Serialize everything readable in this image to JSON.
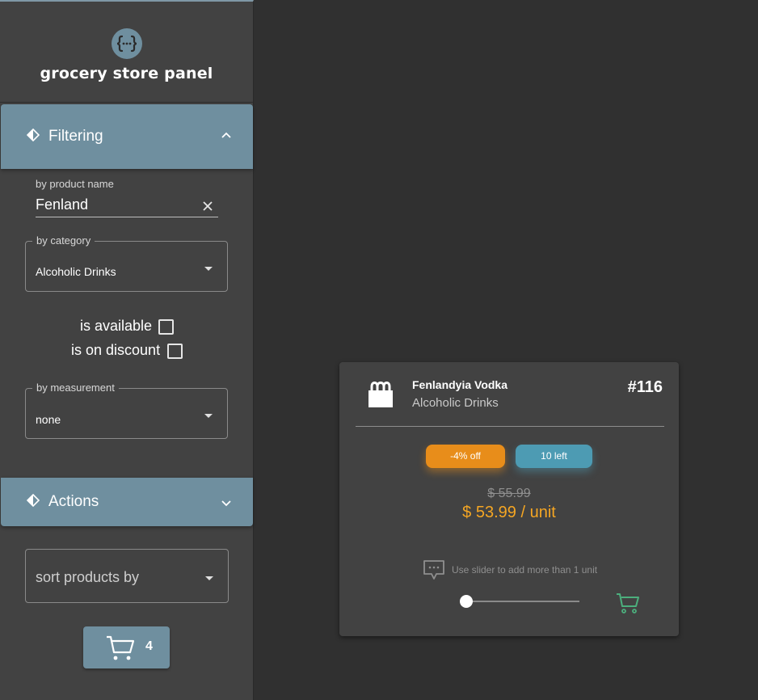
{
  "sidebar": {
    "title": "grocery store panel",
    "filtering": {
      "header_label": "Filtering",
      "name_filter": {
        "label": "by product name",
        "value": "Fenland"
      },
      "category_filter": {
        "label": "by category",
        "value": "Alcoholic Drinks"
      },
      "available_label": "is available",
      "available_checked": false,
      "discount_label": "is on discount",
      "discount_checked": false,
      "measurement_filter": {
        "label": "by measurement",
        "value": "none"
      }
    },
    "actions": {
      "header_label": "Actions"
    },
    "sort_select": {
      "placeholder": "sort products by"
    },
    "cart": {
      "count": "4"
    }
  },
  "product": {
    "name": "Fenlandyia Vodka",
    "category": "Alcoholic Drinks",
    "id": "#116",
    "discount_badge": "-4% off",
    "stock_badge": "10 left",
    "old_price": "$ 55.99",
    "new_price": "$ 53.99 / unit",
    "slider_hint": "Use slider to add more than 1 unit",
    "slider_value": 1
  },
  "colors": {
    "background": "#303030",
    "surface": "#424242",
    "accent": "#6f8f9f",
    "discount": "#e88d1a",
    "stock": "#4d9bb3",
    "price": "#f5a623",
    "cart_green": "#4caf7d"
  }
}
